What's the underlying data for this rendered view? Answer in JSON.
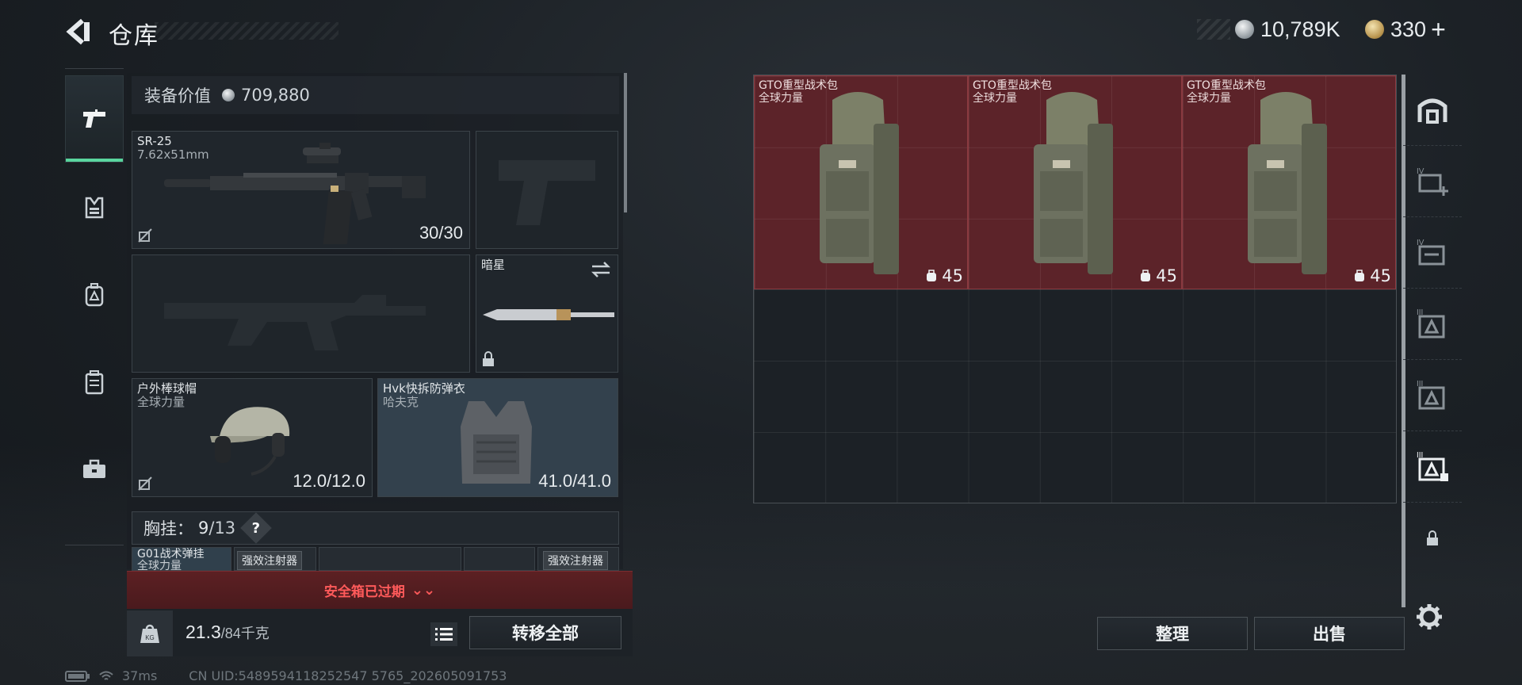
{
  "header": {
    "title": "仓库",
    "silver": "10,789K",
    "gold": "330"
  },
  "left_tabs": [
    "pistol-icon",
    "armor-icon",
    "backpack-icon",
    "chest-rig-icon",
    "briefcase-icon"
  ],
  "loadout": {
    "value_label": "装备价值",
    "value": "709,880",
    "primary": {
      "name": "SR-25",
      "caliber": "7.62x51mm",
      "durability": "30/30"
    },
    "melee": {
      "name": "暗星"
    },
    "helmet": {
      "name": "户外棒球帽",
      "brand": "全球力量",
      "durability": "12.0/12.0"
    },
    "vest": {
      "name": "Hvk快拆防弹衣",
      "brand": "哈夫克",
      "durability": "41.0/41.0"
    },
    "chest_rig": {
      "label": "胸挂：",
      "used": "9",
      "total": "/13"
    },
    "rig_items": [
      {
        "name": "G01战术弹挂",
        "sub": "全球力量",
        "tag": "强效注射器"
      },
      {
        "tag": "强效注射器"
      }
    ],
    "warning": "安全箱已过期",
    "weight": "21.3",
    "weight_max": "/84千克",
    "transfer_all": "转移全部"
  },
  "stash": {
    "bags": [
      {
        "name": "GTO重型战术包",
        "brand": "全球力量",
        "capacity": "45"
      },
      {
        "name": "GTO重型战术包",
        "brand": "全球力量",
        "capacity": "45"
      },
      {
        "name": "GTO重型战术包",
        "brand": "全球力量",
        "capacity": "45"
      }
    ],
    "sort": "整理",
    "sell": "出售"
  },
  "right_tabs": [
    "stash-icon",
    "storage-iv-add-icon",
    "storage-iv-icon",
    "storage-iii-icon",
    "storage-iii-icon",
    "storage-iii-icon-active",
    "lock-icon"
  ],
  "status": {
    "ping": "37ms",
    "uid": "CN UID:5489594118252547 5765_202605091753"
  }
}
